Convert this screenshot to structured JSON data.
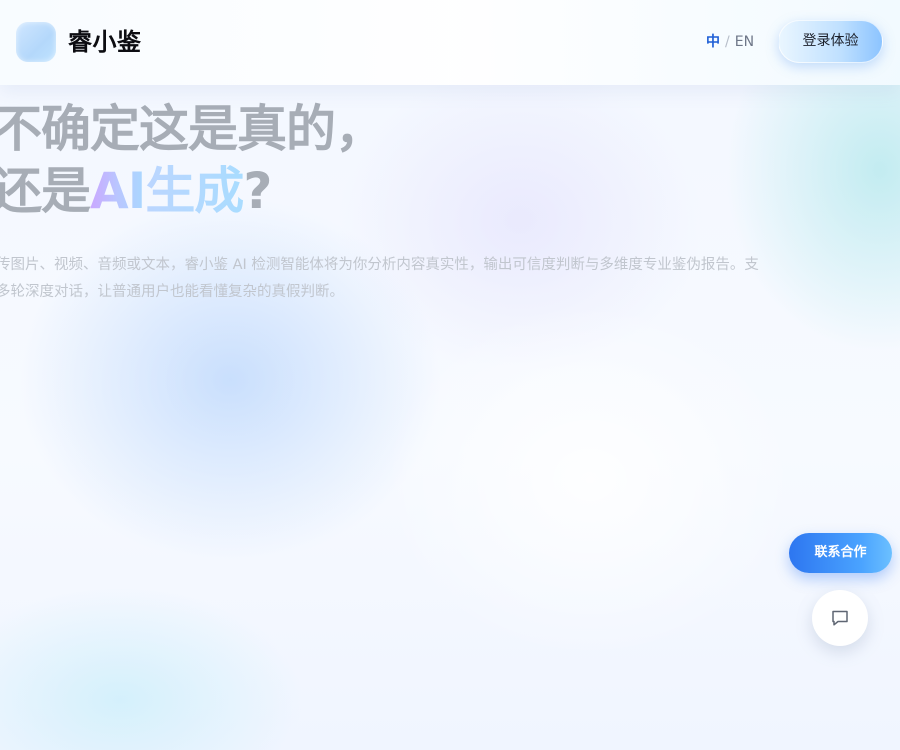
{
  "brand": {
    "name": "睿小鉴"
  },
  "header": {
    "lang_zh": "中",
    "lang_sep": "/",
    "lang_en": "EN",
    "login_label": "登录体验"
  },
  "hero": {
    "title_line1": "不确定这是真的，",
    "title_line2_prefix": "还是",
    "title_line2_ai": "AI",
    "title_line2_gen": "生成",
    "title_line2_suffix": "?",
    "desc_line1": "传图片、视频、音频或文本，睿小鉴 AI 检测智能体将为你分析内容真实性，输出可信度判断与多维度专业鉴伪报告。支",
    "desc_line2": "多轮深度对话，让普通用户也能看懂复杂的真假判断。"
  },
  "floating": {
    "contact_label": "联系合作",
    "chat_icon": "chat-bubble-icon"
  },
  "colors": {
    "accent": "#2d76f0",
    "lang_active": "#1f5fd6",
    "title_gray": "#a7adb6"
  }
}
